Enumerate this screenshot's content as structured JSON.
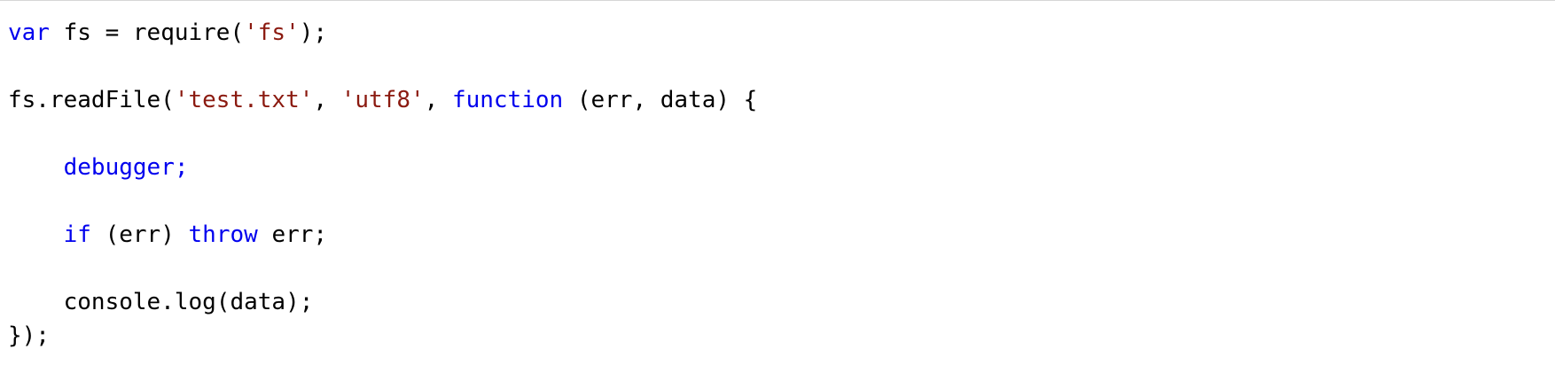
{
  "code_lines": [
    {
      "segments": [
        {
          "type": "kw",
          "text": "var"
        },
        {
          "type": "plain",
          "text": " fs = require("
        },
        {
          "type": "str",
          "text": "'fs'"
        },
        {
          "type": "plain",
          "text": ");"
        }
      ]
    },
    {
      "segments": []
    },
    {
      "segments": [
        {
          "type": "plain",
          "text": "fs.readFile("
        },
        {
          "type": "str",
          "text": "'test.txt'"
        },
        {
          "type": "plain",
          "text": ", "
        },
        {
          "type": "str",
          "text": "'utf8'"
        },
        {
          "type": "plain",
          "text": ", "
        },
        {
          "type": "kw",
          "text": "function"
        },
        {
          "type": "plain",
          "text": " (err, data) {"
        }
      ]
    },
    {
      "segments": []
    },
    {
      "segments": [
        {
          "type": "plain",
          "text": "    "
        },
        {
          "type": "kw",
          "text": "debugger;"
        }
      ]
    },
    {
      "segments": []
    },
    {
      "segments": [
        {
          "type": "plain",
          "text": "    "
        },
        {
          "type": "kw",
          "text": "if"
        },
        {
          "type": "plain",
          "text": " (err) "
        },
        {
          "type": "kw",
          "text": "throw"
        },
        {
          "type": "plain",
          "text": " err;"
        }
      ]
    },
    {
      "segments": []
    },
    {
      "segments": [
        {
          "type": "plain",
          "text": "    console.log(data);"
        }
      ]
    },
    {
      "segments": [
        {
          "type": "plain",
          "text": "});"
        }
      ]
    }
  ],
  "colors": {
    "keyword": "#0000ee",
    "string": "#8b1a10",
    "plain": "#000000"
  }
}
